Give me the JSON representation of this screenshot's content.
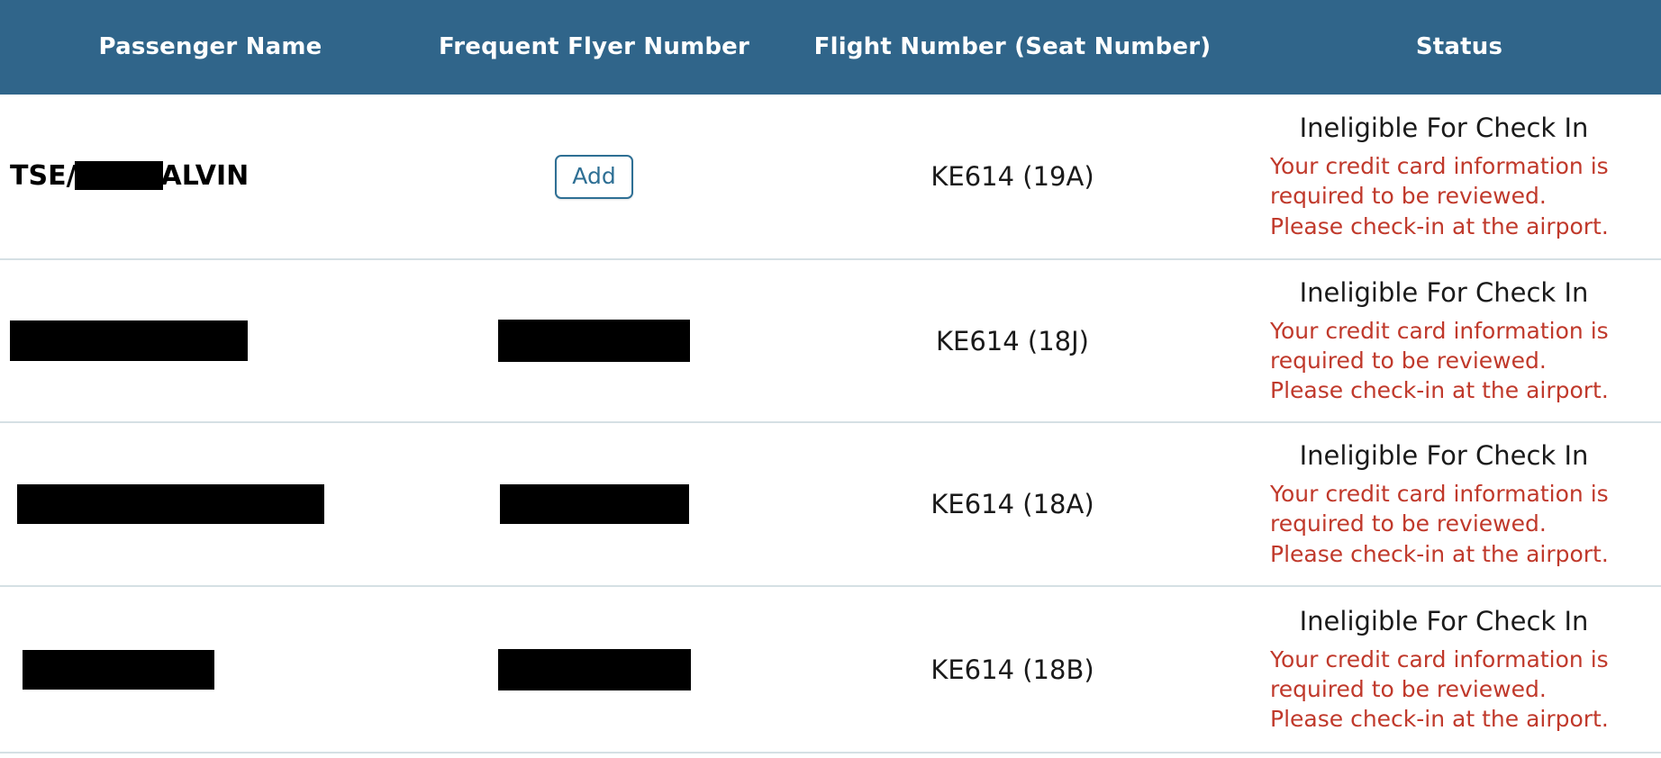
{
  "table": {
    "columns": [
      {
        "key": "passenger_name",
        "label": "Passenger Name"
      },
      {
        "key": "frequent_flyer_number",
        "label": "Frequent Flyer Number"
      },
      {
        "key": "flight_number",
        "label": "Flight Number (Seat Number)"
      },
      {
        "key": "status",
        "label": "Status"
      }
    ],
    "colors": {
      "header_background": "#30658a",
      "header_text": "#ffffff",
      "row_divider": "#d5e0e4",
      "status_warning_text": "#c0392b",
      "status_title_text": "#1a1a1a",
      "add_button_accent": "#2e6f94",
      "redaction_fill": "#000000"
    },
    "rows": [
      {
        "passenger_name_prefix": "TSE/",
        "passenger_name_suffix": "ALVIN",
        "passenger_name_redacted": true,
        "frequent_flyer_action_label": "Add",
        "frequent_flyer_redacted": false,
        "flight_number": "KE614 (19A)",
        "status_title": "Ineligible For Check In",
        "status_message": "Your credit card information is required to be reviewed. Please check-in at the airport."
      },
      {
        "passenger_name_prefix": "",
        "passenger_name_suffix": "",
        "passenger_name_redacted": true,
        "frequent_flyer_action_label": "",
        "frequent_flyer_redacted": true,
        "flight_number": "KE614 (18J)",
        "status_title": "Ineligible For Check In",
        "status_message": "Your credit card information is required to be reviewed. Please check-in at the airport."
      },
      {
        "passenger_name_prefix": "",
        "passenger_name_suffix": "",
        "passenger_name_redacted": true,
        "frequent_flyer_action_label": "",
        "frequent_flyer_redacted": true,
        "flight_number": "KE614 (18A)",
        "status_title": "Ineligible For Check In",
        "status_message": "Your credit card information is required to be reviewed. Please check-in at the airport."
      },
      {
        "passenger_name_prefix": "",
        "passenger_name_suffix": "",
        "passenger_name_redacted": true,
        "frequent_flyer_action_label": "",
        "frequent_flyer_redacted": true,
        "flight_number": "KE614 (18B)",
        "status_title": "Ineligible For Check In",
        "status_message": "Your credit card information is required to be reviewed. Please check-in at the airport."
      }
    ]
  }
}
